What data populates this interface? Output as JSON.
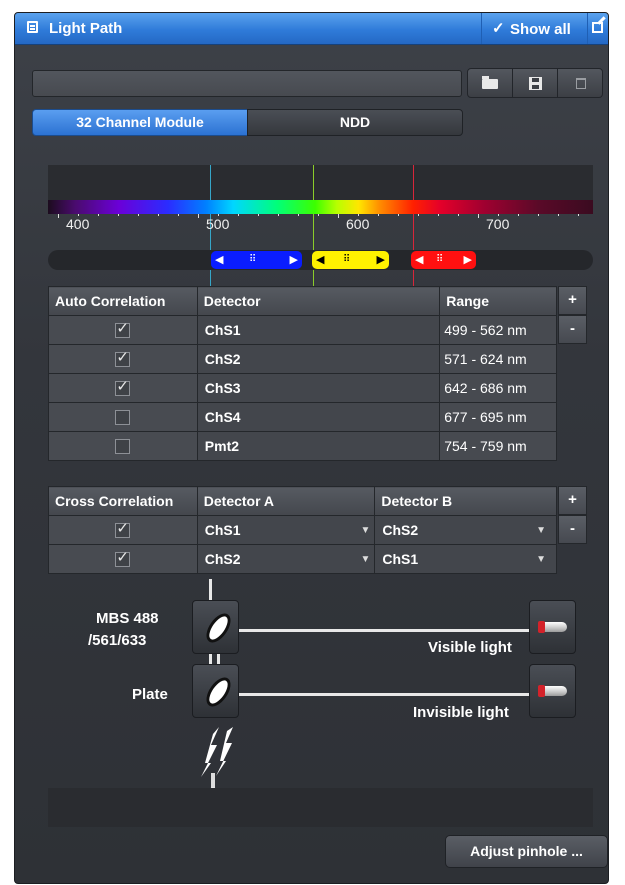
{
  "panel": {
    "title": "Light Path",
    "show_all_label": "Show all",
    "accent_color": "#2f7bd9",
    "icons": [
      "light-path-icon",
      "checkmark-icon",
      "undock-icon",
      "folder-open-icon",
      "save-icon",
      "delete-icon"
    ]
  },
  "tabs": [
    {
      "label": "32 Channel Module",
      "active": true
    },
    {
      "label": "NDD",
      "active": false
    }
  ],
  "spectrum": {
    "ticks": [
      "400",
      "500",
      "600",
      "700"
    ],
    "laser_lines_nm": [
      488,
      561,
      633
    ],
    "ranges": [
      {
        "color": "#0a1dff",
        "from": 499,
        "to": 562
      },
      {
        "color": "#fff200",
        "from": 571,
        "to": 624
      },
      {
        "color": "#ff1010",
        "from": 642,
        "to": 686
      }
    ]
  },
  "auto_table": {
    "headers": [
      "Auto Correlation",
      "Detector",
      "Range"
    ],
    "plus_label": "+",
    "minus_label": "-",
    "rows": [
      {
        "checked": true,
        "detector": "ChS1",
        "range": "499 - 562 nm"
      },
      {
        "checked": true,
        "detector": "ChS2",
        "range": "571 - 624 nm"
      },
      {
        "checked": true,
        "detector": "ChS3",
        "range": "642 - 686 nm"
      },
      {
        "checked": false,
        "detector": "ChS4",
        "range": "677 - 695 nm"
      },
      {
        "checked": false,
        "detector": "Pmt2",
        "range": "754 - 759 nm"
      }
    ]
  },
  "cross_table": {
    "headers": [
      "Cross Correlation",
      "Detector A",
      "Detector B"
    ],
    "plus_label": "+",
    "minus_label": "-",
    "rows": [
      {
        "checked": true,
        "a": "ChS1",
        "b": "ChS2"
      },
      {
        "checked": true,
        "a": "ChS2",
        "b": "ChS1"
      }
    ]
  },
  "light_path": {
    "mbs_label_line1": "MBS 488",
    "mbs_label_line2": "/561/633",
    "plate_label": "Plate",
    "visible_label": "Visible light",
    "invisible_label": "Invisible light"
  },
  "adjust_pinhole_label": "Adjust pinhole ..."
}
